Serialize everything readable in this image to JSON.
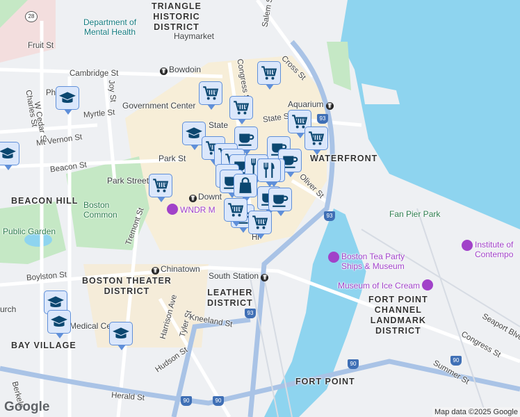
{
  "districts": {
    "triangle": "TRIANGLE\nHISTORIC\nDISTRICT",
    "beacon_hill": "BEACON HILL",
    "theater": "BOSTON THEATER\nDISTRICT",
    "leather": "LEATHER\nDISTRICT",
    "bay_village": "BAY VILLAGE",
    "waterfront": "WATERFRONT",
    "fort_point_channel": "FORT POINT\nCHANNEL\nLANDMARK\nDISTRICT",
    "fort_point": "FORT POINT"
  },
  "places": {
    "mental_health": "Department of\nMental Health",
    "haymarket": "Haymarket",
    "bowdoin": "Bowdoin",
    "government_center": "Government Center",
    "state": "State",
    "aquarium": "Aquarium",
    "park_st": "Park St",
    "park_street": "Park Street",
    "downtown": "Downt",
    "wndr": "WNDR M",
    "boston_common": "Boston\nCommon",
    "public_garden": "Public Garden",
    "chinatown": "Chinatown",
    "south_station": "South Station",
    "tea_party": "Boston Tea Party\nShips & Museum",
    "ice_cream": "Museum of Ice Cream",
    "fan_pier": "Fan Pier Park",
    "institute": "Institute of\nContempo",
    "medical": "Medical Ce",
    "church": "urch"
  },
  "streets": {
    "fruit": "Fruit St",
    "cambridge": "Cambridge St",
    "charles": "Charles St",
    "w_cedar": "W Cedar St",
    "joy": "Joy St",
    "myrtle": "Myrtle St",
    "mt_vernon": "Mt Vernon St",
    "beacon": "Beacon St",
    "tremont": "Tremont St",
    "boylston": "Boylston St",
    "congress": "Congress St",
    "cross": "Cross St",
    "salem": "Salem St",
    "state_st": "State St",
    "oliver": "Oliver St",
    "harrison": "Harrison Ave",
    "tyler": "Tyler St",
    "kneeland": "Kneeland St",
    "hudson": "Hudson St",
    "herald": "Herald St",
    "berkeley": "Berkele",
    "seaport": "Seaport Blvd",
    "congress2": "Congress St",
    "summer": "Summer St",
    "hi": "Hi",
    "ph": "Ph"
  },
  "highways": {
    "i93": "93",
    "i90": "90",
    "r28": "28"
  },
  "markers": [
    "cart",
    "cart",
    "cart",
    "education",
    "education",
    "education",
    "cup",
    "cart",
    "cart",
    "cart",
    "cup",
    "cup",
    "cart",
    "cart",
    "cup",
    "restaurant",
    "restaurant",
    "cup",
    "cup",
    "cart",
    "shopping-bag",
    "cup",
    "cup",
    "cup",
    "cart",
    "education",
    "education",
    "education",
    "restaurant",
    "cart"
  ],
  "footer": {
    "google": "Google",
    "attribution": "Map data ©2025 Google"
  },
  "colors": {
    "water": "#8ed4ef",
    "park": "#c5e8c5",
    "downtown": "#f7eed8",
    "marker_fill": "#dbe7fb",
    "marker_border": "#5f8fd9",
    "marker_icon": "#0b4770"
  }
}
